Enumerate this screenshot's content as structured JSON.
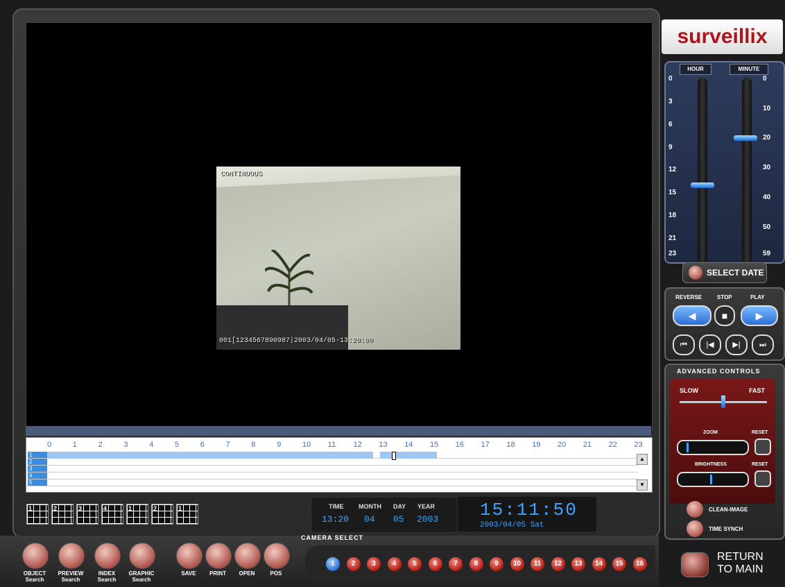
{
  "video": {
    "overlay_mode": "CONTINUOUS",
    "overlay_stamp": "001[1234567890987|2003/04/05-13:20:00"
  },
  "timeline": {
    "hours": [
      "0",
      "1",
      "2",
      "3",
      "4",
      "5",
      "6",
      "7",
      "8",
      "9",
      "10",
      "11",
      "12",
      "13",
      "14",
      "15",
      "16",
      "17",
      "18",
      "19",
      "20",
      "21",
      "22",
      "23"
    ],
    "rows": [
      "1",
      "2",
      "3",
      "4",
      "5"
    ]
  },
  "split_buttons": [
    "1",
    "2",
    "3",
    "4",
    "1",
    "2",
    "1"
  ],
  "datetime": {
    "time_label": "TIME",
    "month_label": "MONTH",
    "day_label": "DAY",
    "year_label": "YEAR",
    "time": "13:20",
    "month": "04",
    "day": "05",
    "year": "2003"
  },
  "clock": {
    "time": "15:11:50",
    "date": "2003/04/05 Sat"
  },
  "camera_select_label": "CAMERA SELECT",
  "cameras": [
    "1",
    "2",
    "3",
    "4",
    "5",
    "6",
    "7",
    "8",
    "9",
    "10",
    "11",
    "12",
    "13",
    "14",
    "15",
    "16"
  ],
  "tools": [
    {
      "label1": "OBJECT",
      "label2": "Search"
    },
    {
      "label1": "PREVIEW",
      "label2": "Search"
    },
    {
      "label1": "INDEX",
      "label2": "Search"
    },
    {
      "label1": "GRAPHIC",
      "label2": "Search"
    },
    {
      "label1": "SAVE",
      "label2": ""
    },
    {
      "label1": "PRINT",
      "label2": ""
    },
    {
      "label1": "OPEN",
      "label2": ""
    },
    {
      "label1": "POS",
      "label2": ""
    }
  ],
  "brand": "surveillix",
  "hour_minute": {
    "hour_label": "HOUR",
    "minute_label": "MINUTE",
    "hour_ticks": [
      "0",
      "3",
      "6",
      "9",
      "12",
      "15",
      "18",
      "21",
      "23"
    ],
    "minute_ticks": [
      "0",
      "10",
      "20",
      "30",
      "40",
      "50",
      "59"
    ],
    "hour_value": 14,
    "minute_value": 20
  },
  "select_date": "SELECT DATE",
  "playback": {
    "reverse": "REVERSE",
    "stop": "STOP",
    "play": "PLAY"
  },
  "advanced": {
    "title": "ADVANCED CONTROLS",
    "slow": "SLOW",
    "fast": "FAST",
    "zoom": "ZOOM",
    "reset": "RESET",
    "brightness": "BRIGHTNESS"
  },
  "clean_image": "CLEAN-IMAGE",
  "time_synch": "TIME SYNCH",
  "return_main": {
    "line1": "RETURN",
    "line2": "TO MAIN"
  }
}
